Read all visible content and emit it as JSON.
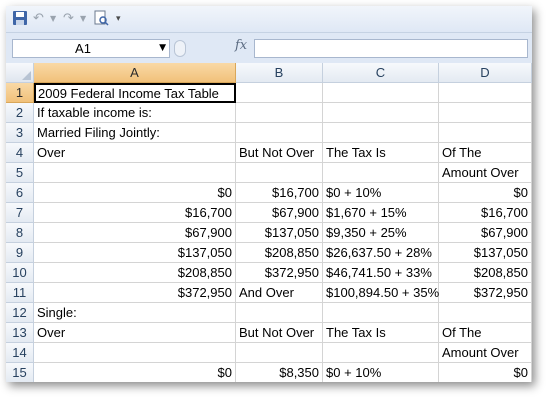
{
  "toolbar": {
    "icons": [
      "save-icon",
      "undo-icon",
      "dropdown-icon",
      "redo-icon",
      "dropdown-icon",
      "print-preview-icon",
      "customize-icon"
    ]
  },
  "formula_bar": {
    "name_box": "A1",
    "fx_label": "fx",
    "formula": ""
  },
  "columns": [
    "A",
    "B",
    "C",
    "D"
  ],
  "selected_column": "A",
  "selected_row": "1",
  "rows": [
    {
      "num": "1",
      "a": "2009 Federal Income Tax Table",
      "b": "",
      "c": "",
      "d": ""
    },
    {
      "num": "2",
      "a": "If taxable income is:",
      "b": "",
      "c": "",
      "d": ""
    },
    {
      "num": "3",
      "a": "Married Filing Jointly:",
      "b": "",
      "c": "",
      "d": ""
    },
    {
      "num": "4",
      "a": "Over",
      "b": "But Not Over",
      "c": "The Tax Is",
      "d": "Of The"
    },
    {
      "num": "5",
      "a": "",
      "b": "",
      "c": "",
      "d": "Amount Over"
    },
    {
      "num": "6",
      "a": "$0",
      "b": "$16,700",
      "c": "$0 + 10%",
      "d": "$0"
    },
    {
      "num": "7",
      "a": "$16,700",
      "b": "$67,900",
      "c": "$1,670 + 15%",
      "d": "$16,700"
    },
    {
      "num": "8",
      "a": "$67,900",
      "b": "$137,050",
      "c": "$9,350 + 25%",
      "d": "$67,900"
    },
    {
      "num": "9",
      "a": "$137,050",
      "b": "$208,850",
      "c": "$26,637.50 + 28%",
      "d": "$137,050"
    },
    {
      "num": "10",
      "a": "$208,850",
      "b": "$372,950",
      "c": "$46,741.50 + 33%",
      "d": "$208,850"
    },
    {
      "num": "11",
      "a": "$372,950",
      "b": "And Over",
      "c": "$100,894.50 + 35%",
      "d": "$372,950"
    },
    {
      "num": "12",
      "a": "Single:",
      "b": "",
      "c": "",
      "d": ""
    },
    {
      "num": "13",
      "a": "Over",
      "b": "But Not Over",
      "c": "The Tax Is",
      "d": "Of The"
    },
    {
      "num": "14",
      "a": "",
      "b": "",
      "c": "",
      "d": "Amount Over"
    },
    {
      "num": "15",
      "a": "$0",
      "b": "$8,350",
      "c": "$0 + 10%",
      "d": "$0"
    }
  ]
}
